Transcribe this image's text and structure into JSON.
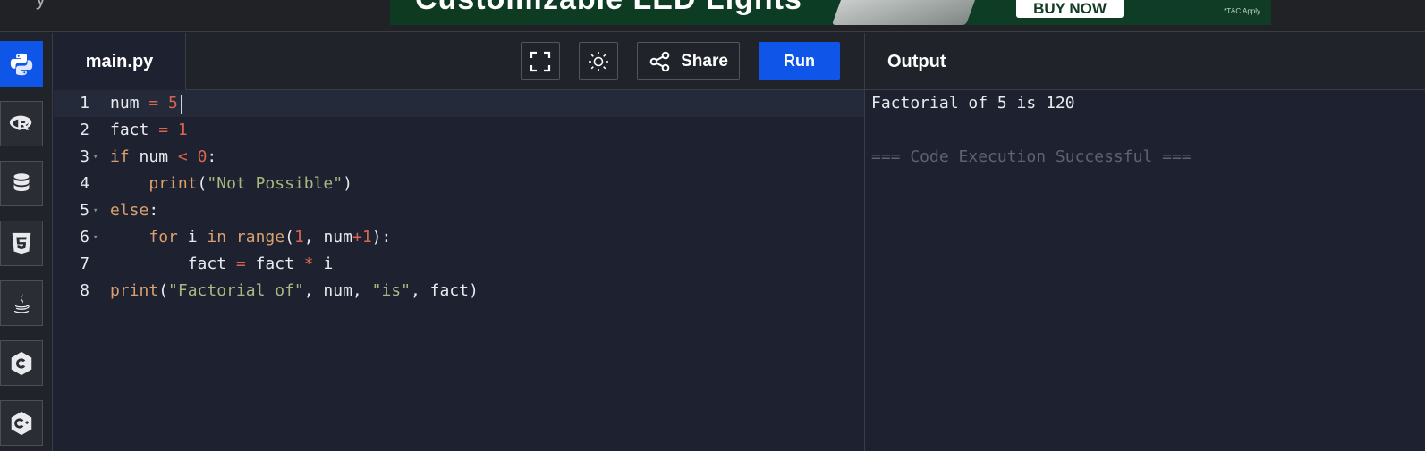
{
  "topbar": {
    "left_text": "y",
    "ad": {
      "headline": "Customizable LED Lights",
      "cta": "BUY NOW",
      "terms": "*T&C Apply"
    }
  },
  "rail": {
    "languages": [
      {
        "icon": "python-icon",
        "active": true
      },
      {
        "icon": "r-language-icon",
        "active": false
      },
      {
        "icon": "database-icon",
        "active": false
      },
      {
        "icon": "html5-icon",
        "active": false
      },
      {
        "icon": "java-icon",
        "active": false
      },
      {
        "icon": "c-language-icon",
        "active": false
      },
      {
        "icon": "cpp-language-icon",
        "active": false
      }
    ]
  },
  "editor": {
    "file_name": "main.py",
    "toolbar": {
      "fullscreen_icon": "fullscreen-icon",
      "theme_icon": "sun-icon",
      "share_label": "Share",
      "share_icon": "share-icon",
      "run_label": "Run"
    },
    "lines": [
      {
        "number": "1",
        "fold": "",
        "code": "num = 5"
      },
      {
        "number": "2",
        "fold": "",
        "code": "fact = 1"
      },
      {
        "number": "3",
        "fold": "▾",
        "code": "if num < 0:"
      },
      {
        "number": "4",
        "fold": "",
        "code": "    print(\"Not Possible\")"
      },
      {
        "number": "5",
        "fold": "▾",
        "code": "else:"
      },
      {
        "number": "6",
        "fold": "▾",
        "code": "    for i in range(1, num+1):"
      },
      {
        "number": "7",
        "fold": "",
        "code": "        fact = fact * i"
      },
      {
        "number": "8",
        "fold": "",
        "code": "print(\"Factorial of\", num, \"is\", fact)"
      }
    ]
  },
  "output": {
    "title": "Output",
    "result_line": "Factorial of 5 is 120",
    "status_line": "=== Code Execution Successful ==="
  },
  "colors": {
    "accent": "#0f56e8",
    "background": "#1d2130",
    "panel": "#202329",
    "keyword": "#d9a06d",
    "number": "#d9654e",
    "string": "#a9b87f"
  }
}
